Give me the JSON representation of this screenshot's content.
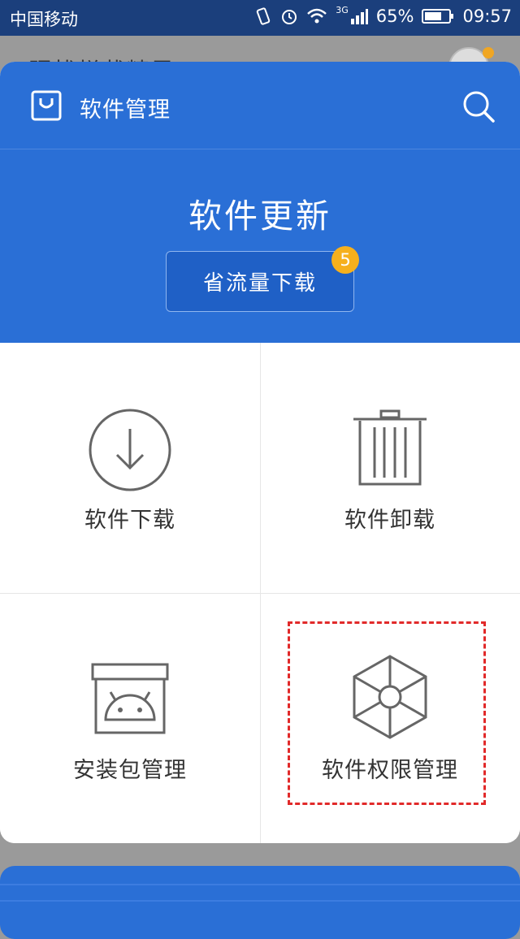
{
  "status_bar": {
    "carrier": "中国移动",
    "network": "3G",
    "battery": "65%",
    "time": "09:57"
  },
  "background_page": {
    "title_partial": "骚扰拦截精灵"
  },
  "header": {
    "title": "软件管理",
    "icon": "shopping-bag-icon",
    "search_icon": "search-icon"
  },
  "update_section": {
    "title": "软件更新",
    "button_label": "省流量下载",
    "badge_count": "5"
  },
  "grid_items": [
    {
      "label": "软件下载",
      "icon": "download-circle-icon"
    },
    {
      "label": "软件卸载",
      "icon": "trash-icon"
    },
    {
      "label": "安装包管理",
      "icon": "android-package-icon"
    },
    {
      "label": "软件权限管理",
      "icon": "hexagon-permission-icon"
    }
  ],
  "colors": {
    "primary": "#2a6fd6",
    "badge": "#f6b01d",
    "highlight_border": "#e12a2a"
  }
}
